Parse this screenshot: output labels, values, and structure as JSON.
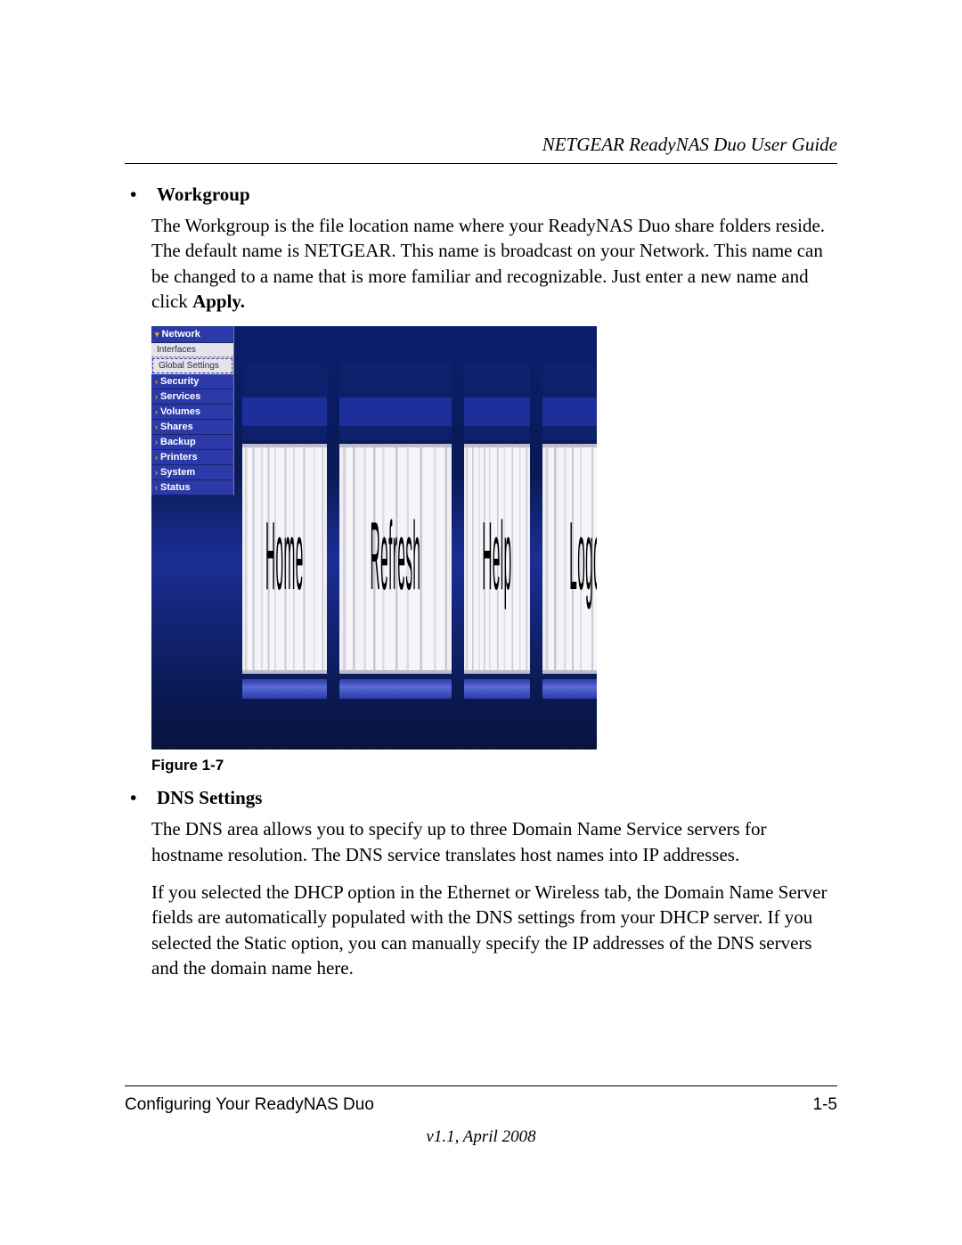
{
  "header": {
    "guide_title": "NETGEAR ReadyNAS Duo User Guide"
  },
  "sections": {
    "workgroup": {
      "heading": "Workgroup",
      "para_part1": "The Workgroup is the file location name where your ReadyNAS Duo share folders reside. The default name is NETGEAR. This name is broadcast on your Network. This name can be changed to a name that is more familiar and recognizable. Just enter a new name and click ",
      "apply_word": "Apply."
    },
    "dns": {
      "heading": "DNS Settings",
      "para1": "The DNS area allows you to specify up to three Domain Name Service servers for hostname resolution. The DNS service translates host names into IP addresses.",
      "para2": "If you selected the DHCP option in the Ethernet or Wireless tab, the Domain Name Server fields are automatically populated with the DNS settings from your DHCP server. If you selected the Static option, you can manually specify the IP addresses of the DNS servers and the domain name here."
    }
  },
  "figure": {
    "caption": "Figure 1-7",
    "sidebar": {
      "expanded": "Network",
      "subs": [
        "Interfaces",
        "Global Settings"
      ],
      "items": [
        "Security",
        "Services",
        "Volumes",
        "Shares",
        "Backup",
        "Printers",
        "System",
        "Status"
      ]
    },
    "toolbar_buttons": [
      "Home",
      "Refresh",
      "Help",
      "Logout"
    ]
  },
  "footer": {
    "section_title": "Configuring Your ReadyNAS Duo",
    "page_number": "1-5",
    "version_line": "v1.1, April 2008"
  }
}
